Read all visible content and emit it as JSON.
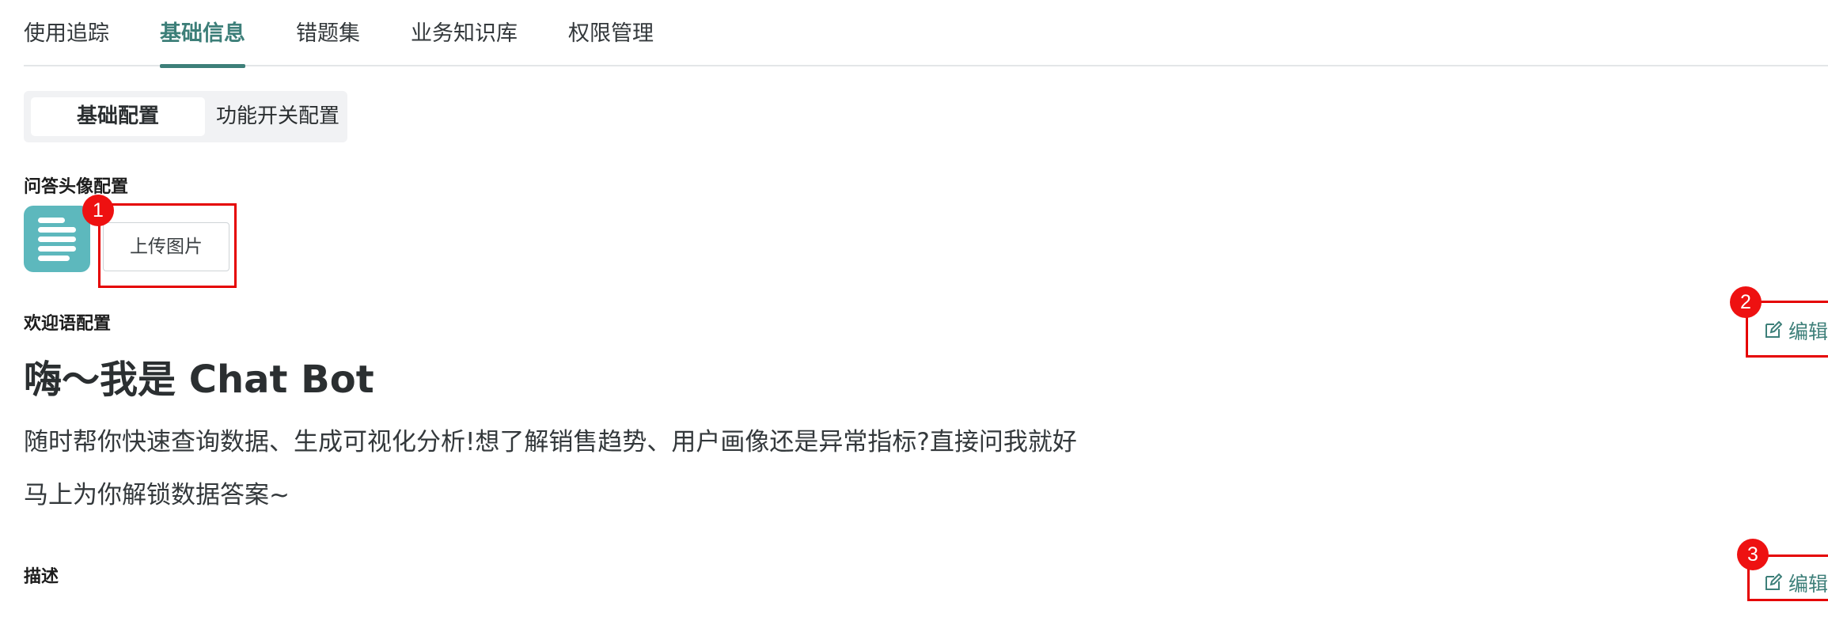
{
  "top_tabs": [
    {
      "label": "使用追踪",
      "active": false
    },
    {
      "label": "基础信息",
      "active": true
    },
    {
      "label": "错题集",
      "active": false
    },
    {
      "label": "业务知识库",
      "active": false
    },
    {
      "label": "权限管理",
      "active": false
    }
  ],
  "sub_tabs": [
    {
      "label": "基础配置",
      "active": true
    },
    {
      "label": "功能开关配置",
      "active": false
    }
  ],
  "avatar_section": {
    "label": "问答头像配置",
    "upload_label": "上传图片",
    "avatar_icon": "lines-icon"
  },
  "welcome_section": {
    "label": "欢迎语配置",
    "title": "嗨～我是 Chat Bot",
    "line1": "随时帮你快速查询数据、生成可视化分析!想了解销售趋势、用户画像还是异常指标?直接问我就好",
    "line2": "马上为你解锁数据答案~",
    "edit_label": "编辑"
  },
  "description_section": {
    "label": "描述",
    "edit_label": "编辑"
  },
  "annotations": {
    "badge1": "1",
    "badge2": "2",
    "badge3": "3"
  },
  "colors": {
    "accent": "#3d7f79",
    "avatar_bg": "#5db8bd",
    "highlight": "#e50000"
  }
}
